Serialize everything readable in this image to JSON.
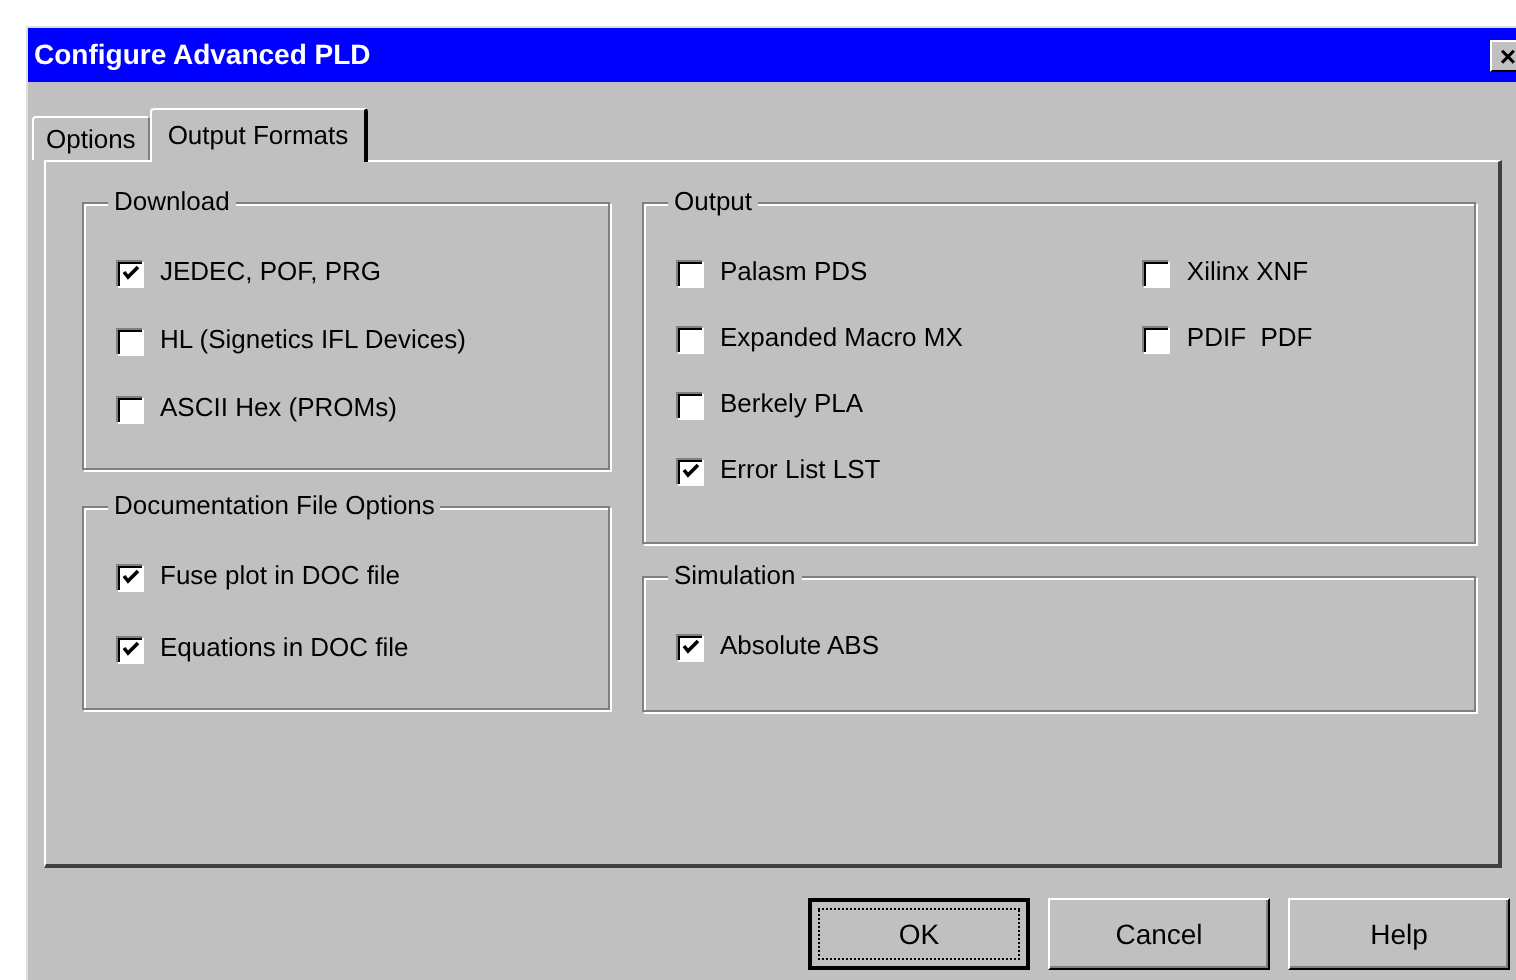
{
  "window": {
    "title": "Configure Advanced PLD",
    "close": "×"
  },
  "tabs": [
    {
      "label": "Options",
      "selected": false
    },
    {
      "label": "Output Formats",
      "selected": true
    }
  ],
  "left_groups": [
    {
      "title": "Download",
      "columns": [
        [
          {
            "label": "JEDEC, POF, PRG",
            "checked": true
          },
          {
            "label": "HL (Signetics IFL Devices)",
            "checked": false
          },
          {
            "label": "ASCII Hex (PROMs)",
            "checked": false
          }
        ]
      ]
    },
    {
      "title": "Documentation File Options",
      "columns": [
        [
          {
            "label": "Fuse plot in DOC file",
            "checked": true
          },
          {
            "label": "Equations in DOC file",
            "checked": true
          }
        ]
      ]
    }
  ],
  "right_groups": [
    {
      "title": "Output",
      "columns": [
        [
          {
            "label": "Palasm PDS",
            "checked": false
          },
          {
            "label": "Expanded Macro MX",
            "checked": false
          },
          {
            "label": "Berkely PLA",
            "checked": false
          },
          {
            "label": "Error List LST",
            "checked": true
          }
        ],
        [
          {
            "label": "Xilinx XNF",
            "checked": false
          },
          {
            "label": "PDIF  PDF",
            "checked": false
          }
        ]
      ]
    },
    {
      "title": "Simulation",
      "columns": [
        [
          {
            "label": "Absolute ABS",
            "checked": true
          }
        ]
      ]
    }
  ],
  "buttons": [
    {
      "label": "OK",
      "focused": true
    },
    {
      "label": "Cancel",
      "focused": false
    },
    {
      "label": "Help",
      "focused": false
    }
  ]
}
